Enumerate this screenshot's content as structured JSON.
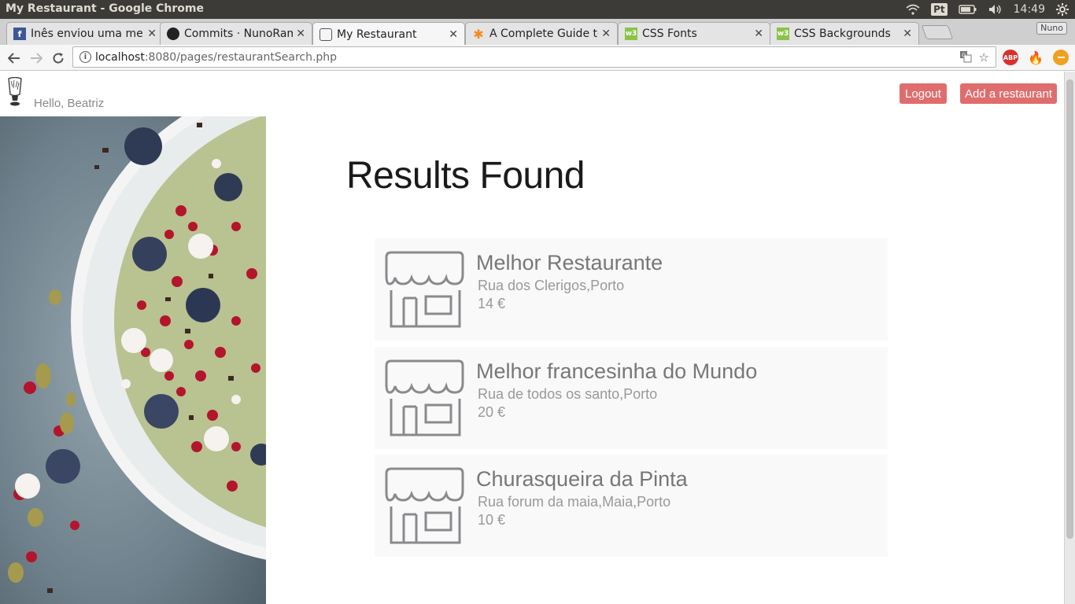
{
  "os": {
    "window_title": "My Restaurant - Google Chrome",
    "tray": {
      "keyboard_layout": "Pt",
      "clock": "14:49"
    }
  },
  "browser": {
    "tabs": [
      {
        "label": "Inês enviou uma mensagem",
        "favicon": "facebook-icon",
        "favicon_color": "#3b5998"
      },
      {
        "label": "Commits · NunoRamos",
        "favicon": "github-icon",
        "favicon_color": "#222222"
      },
      {
        "label": "My Restaurant",
        "favicon": "restaurant-logo-icon",
        "favicon_color": "#555555"
      },
      {
        "label": "A Complete Guide to",
        "favicon": "asterisk-icon",
        "favicon_color": "#f58a1f"
      },
      {
        "label": "CSS Fonts",
        "favicon": "w3schools-icon",
        "favicon_color": "#8bc34a"
      },
      {
        "label": "CSS Backgrounds",
        "favicon": "w3schools-icon",
        "favicon_color": "#8bc34a"
      }
    ],
    "active_tab_index": 2,
    "profile_name": "Nuno",
    "url_host": "localhost",
    "url_rest": ":8080/pages/restaurantSearch.php",
    "extensions": [
      {
        "name": "adblock-plus-icon",
        "label": "ABP",
        "color": "#d9302c"
      },
      {
        "name": "flame-icon",
        "label": "",
        "color": "#e8762b"
      },
      {
        "name": "minus-circle-icon",
        "label": "",
        "color": "#f0a020"
      }
    ]
  },
  "header": {
    "greeting": "Hello, Beatriz",
    "logout_label": "Logout",
    "add_restaurant_label": "Add a restaurant"
  },
  "main": {
    "title": "Results Found",
    "results": [
      {
        "name": "Melhor Restaurante",
        "address": "Rua dos Clerigos,Porto",
        "price": "14 €"
      },
      {
        "name": "Melhor francesinha do Mundo",
        "address": "Rua de todos os santo,Porto",
        "price": "20 €"
      },
      {
        "name": "Churasqueira da Pinta",
        "address": "Rua forum da maia,Maia,Porto",
        "price": "10 €"
      }
    ]
  },
  "colors": {
    "accent_button": "#e06d6d",
    "card_background": "#f9f9f9"
  }
}
